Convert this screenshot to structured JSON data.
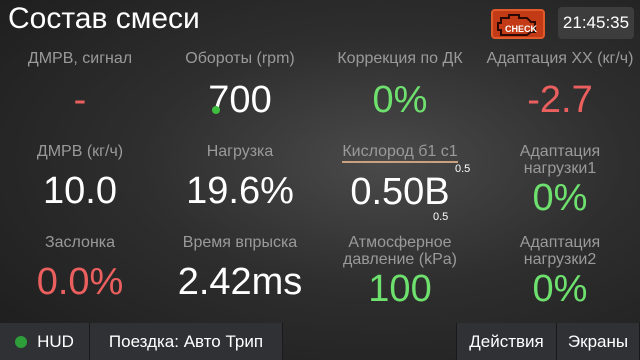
{
  "header": {
    "title": "Состав смеси",
    "check_engine_text": "CHECK",
    "time": "21:45:35"
  },
  "gauges": [
    {
      "label": "ДМРВ, сигнал",
      "value": "-",
      "color": "#ec5f5f"
    },
    {
      "label": "Обороты (rpm)",
      "value": "700",
      "color": "#ffffff"
    },
    {
      "label": "Коррекция по ДК",
      "value": "0%",
      "color": "#6ee06e"
    },
    {
      "label": "Адаптация ХХ (кг/ч)",
      "value": "-2.7",
      "color": "#ec5f5f"
    },
    {
      "label": "ДМРВ (кг/ч)",
      "value": "10.0",
      "color": "#ffffff"
    },
    {
      "label": "Нагрузка",
      "value": "19.6%",
      "color": "#ffffff"
    },
    {
      "label": "Кислород б1 с1",
      "value": "0.50В",
      "color": "#ffffff",
      "sub_top": "0.5",
      "sub_bottom": "0.5"
    },
    {
      "label_line1": "Адаптация",
      "label_line2": "нагрузки1",
      "value": "0%",
      "color": "#6ee06e"
    },
    {
      "label": "Заслонка",
      "value": "0.0%",
      "color": "#ec5f5f"
    },
    {
      "label": "Время впрыска",
      "value": "2.42ms",
      "color": "#ffffff"
    },
    {
      "label_line1": "Атмосферное",
      "label_line2": "давление (kPa)",
      "value": "100",
      "color": "#6ee06e"
    },
    {
      "label_line1": "Адаптация",
      "label_line2": "нагрузки2",
      "value": "0%",
      "color": "#6ee06e"
    }
  ],
  "bottom_bar": {
    "hud": "HUD",
    "trip": "Поездка: Авто Трип",
    "actions": "Действия",
    "screens": "Экраны"
  }
}
